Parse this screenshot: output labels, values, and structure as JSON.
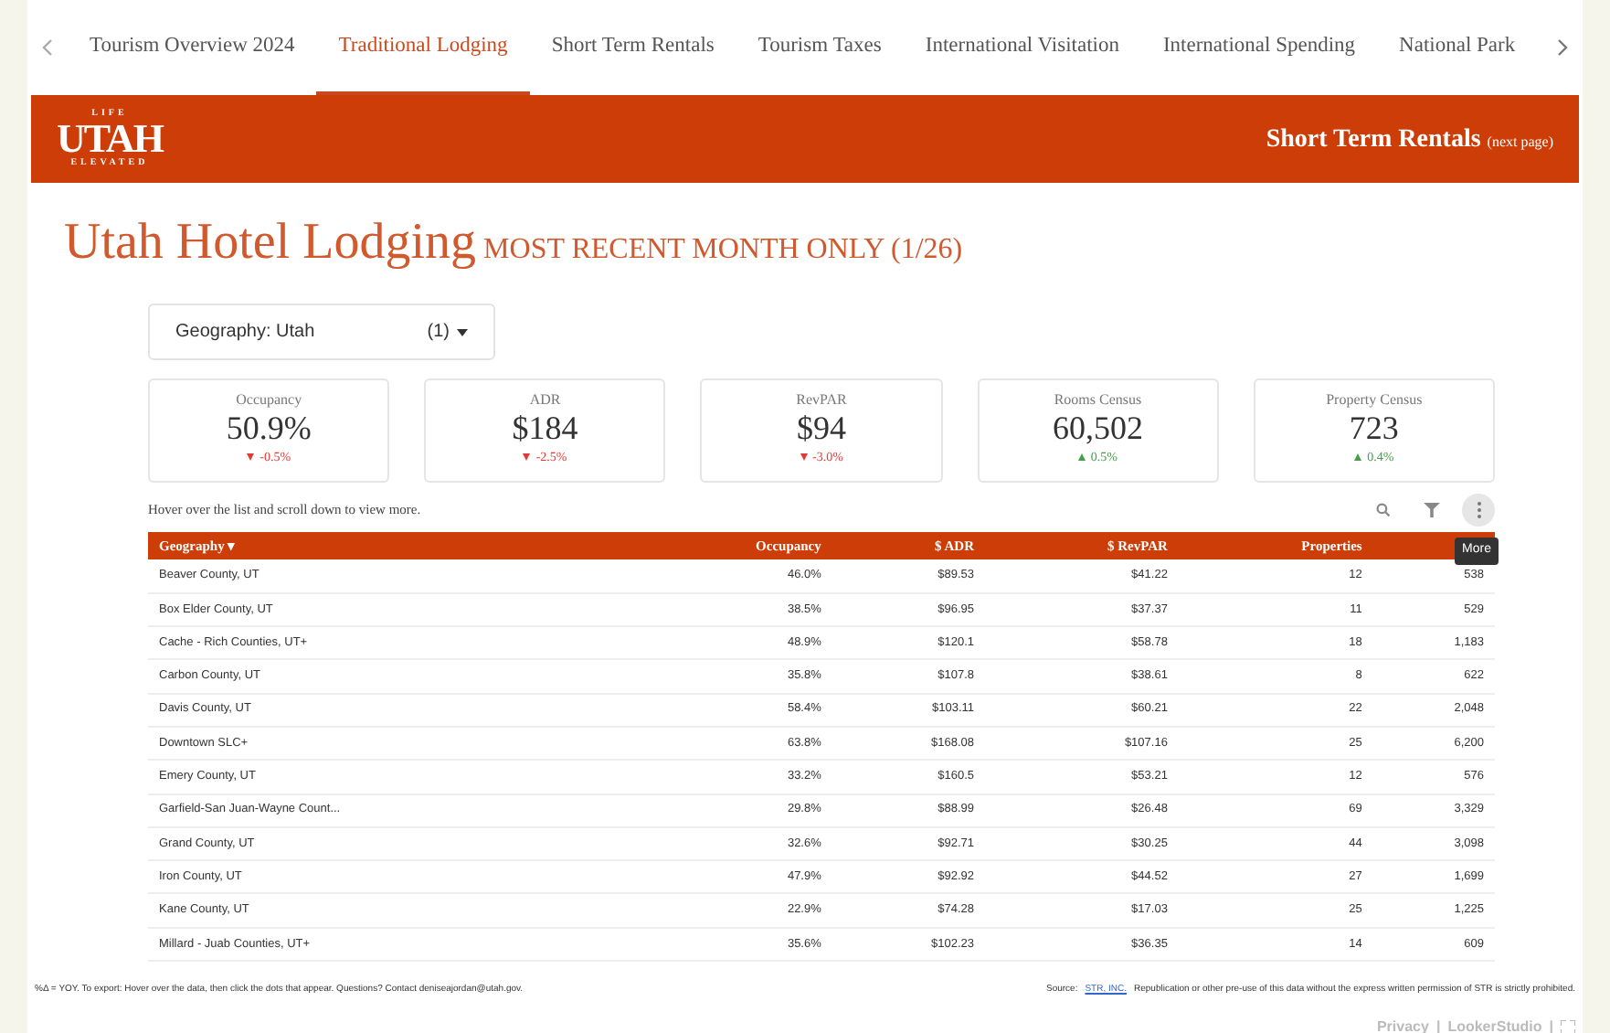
{
  "tabs": [
    {
      "label": "Tourism Overview 2024",
      "selected": false
    },
    {
      "label": "Traditional Lodging",
      "selected": true
    },
    {
      "label": "Short Term Rentals",
      "selected": false
    },
    {
      "label": "Tourism Taxes",
      "selected": false
    },
    {
      "label": "International Visitation",
      "selected": false
    },
    {
      "label": "International Spending",
      "selected": false
    },
    {
      "label": "National Park",
      "selected": false
    }
  ],
  "banner": {
    "logo_top": "LIFE",
    "logo": "UTAH",
    "logo_bottom": "ELEVATED",
    "link": "Short Term Rentals",
    "link_note": "(next page)"
  },
  "title": "Utah Hotel Lodging",
  "subtitle": "MOST RECENT MONTH ONLY (1/26)",
  "filter": {
    "label": "Geography:",
    "value": "Utah",
    "count": "(1)"
  },
  "kpis": [
    {
      "label": "Occupancy",
      "value": "50.9%",
      "change": "-0.5%",
      "increase": false
    },
    {
      "label": "ADR",
      "value": "$184",
      "change": "-2.5%",
      "increase": false
    },
    {
      "label": "RevPAR",
      "value": "$94",
      "change": "-3.0%",
      "increase": false
    },
    {
      "label": "Rooms Census",
      "value": "60,502",
      "change": "0.5%",
      "increase": true
    },
    {
      "label": "Property Census",
      "value": "723",
      "change": "0.4%",
      "increase": true
    }
  ],
  "hint": "Hover over the list and scroll down to view more.",
  "tooltip": "More",
  "table": {
    "columns": [
      "Geography",
      "Occupancy",
      "$ ADR",
      "$ RevPAR",
      "Properties"
    ],
    "sort_mark": "▾",
    "rows": [
      [
        "Beaver County, UT",
        "46.0%",
        "$89.53",
        "$41.22",
        "12",
        "538"
      ],
      [
        "Box Elder County, UT",
        "38.5%",
        "$96.95",
        "$37.37",
        "11",
        "529"
      ],
      [
        "Cache - Rich Counties, UT+",
        "48.9%",
        "$120.1",
        "$58.78",
        "18",
        "1,183"
      ],
      [
        "Carbon County, UT",
        "35.8%",
        "$107.8",
        "$38.61",
        "8",
        "622"
      ],
      [
        "Davis County, UT",
        "58.4%",
        "$103.11",
        "$60.21",
        "22",
        "2,048"
      ],
      [
        "Downtown SLC+",
        "63.8%",
        "$168.08",
        "$107.16",
        "25",
        "6,200"
      ],
      [
        "Emery County, UT",
        "33.2%",
        "$160.5",
        "$53.21",
        "12",
        "576"
      ],
      [
        "Garfield-San Juan-Wayne Count...",
        "29.8%",
        "$88.99",
        "$26.48",
        "69",
        "3,329"
      ],
      [
        "Grand County, UT",
        "32.6%",
        "$92.71",
        "$30.25",
        "44",
        "3,098"
      ],
      [
        "Iron County, UT",
        "47.9%",
        "$92.92",
        "$44.52",
        "27",
        "1,699"
      ],
      [
        "Kane County, UT",
        "22.9%",
        "$74.28",
        "$17.03",
        "25",
        "1,225"
      ],
      [
        "Millard - Juab Counties, UT+",
        "35.6%",
        "$102.23",
        "$36.35",
        "14",
        "609"
      ]
    ]
  },
  "footer": {
    "note": "%Δ = YOY. To export: Hover over the data, then click the dots that appear. Questions? Contact deniseajordan@utah.gov.",
    "source_label": "Source:",
    "source_link": "STR, INC.",
    "source_text": "Republication or other pre-use of this data without the express written permission of STR is strictly prohibited."
  },
  "bottom_links": [
    "Privacy",
    "LookerStudio"
  ],
  "bottom_separator": "|"
}
